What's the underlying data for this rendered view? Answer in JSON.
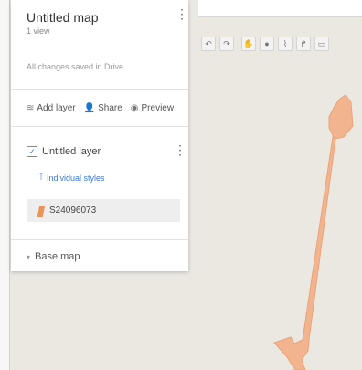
{
  "map": {
    "title": "Untitled map",
    "views": "1 view",
    "save_status": "All changes saved in Drive"
  },
  "actions": {
    "add_layer": "Add layer",
    "share": "Share",
    "preview": "Preview"
  },
  "layer": {
    "name": "Untitled layer",
    "checked": true,
    "styles_link": "Individual styles",
    "feature_label": "S24096073",
    "feature_color": "#e8945a"
  },
  "basemap": {
    "label": "Base map"
  },
  "toolbar_icons": [
    "undo-icon",
    "redo-icon",
    "hand-icon",
    "marker-icon",
    "draw-line-icon",
    "directions-icon",
    "ruler-icon"
  ],
  "colors": {
    "route": "#f2b48e",
    "map_background": "#ebe8e2",
    "link": "#3b78d8"
  }
}
